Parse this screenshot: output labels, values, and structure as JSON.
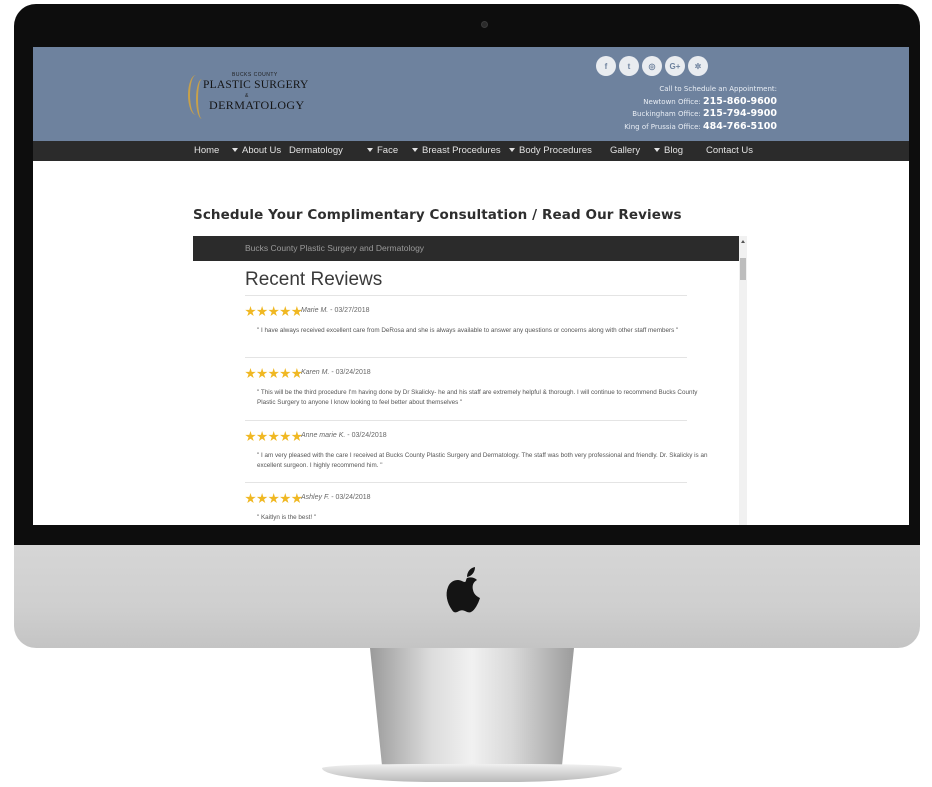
{
  "logo": {
    "small_line": "BUCKS COUNTY",
    "line1": "PLASTIC SURGERY",
    "ampersand": "&",
    "line2": "DERMATOLOGY"
  },
  "social_icons": [
    {
      "name": "facebook-icon",
      "glyph": "f"
    },
    {
      "name": "twitter-icon",
      "glyph": "t"
    },
    {
      "name": "instagram-icon",
      "glyph": "◎"
    },
    {
      "name": "google-plus-icon",
      "glyph": "G+"
    },
    {
      "name": "yelp-icon",
      "glyph": "✲"
    }
  ],
  "contact": {
    "intro": "Call to Schedule an Appointment:",
    "newtown_label": "Newtown Office:",
    "newtown_phone": "215-860-9600",
    "buckingham_label": "Buckingham Office:",
    "buckingham_phone": "215-794-9900",
    "kop_label": "King of Prussia Office:",
    "kop_phone": "484-766-5100"
  },
  "nav": {
    "home": "Home",
    "about": "About Us",
    "dermatology": "Dermatology",
    "face": "Face",
    "breast": "Breast Procedures",
    "body": "Body Procedures",
    "gallery": "Gallery",
    "blog": "Blog",
    "contact": "Contact Us"
  },
  "headline": "Schedule Your Complimentary Consultation / Read Our Reviews",
  "widget": {
    "bar_title": "Bucks County Plastic Surgery and Dermatology",
    "title": "Recent Reviews"
  },
  "reviews": [
    {
      "rating": 5,
      "author": "Marie M.",
      "date": " - 03/27/2018",
      "text": "\" I have always received excellent care from DeRosa and she is always available to answer any questions or concerns along with other staff members \""
    },
    {
      "rating": 5,
      "author": "Karen M.",
      "date": " - 03/24/2018",
      "text": "\" This will be the third procedure I'm having done by Dr Skalicky- he and his staff are extremely helpful & thorough. I will continue to recommend Bucks County Plastic Surgery to anyone I know looking to feel better about themselves \""
    },
    {
      "rating": 5,
      "author": "Anne marie K.",
      "date": " - 03/24/2018",
      "text": "\" I am very pleased with the care I received at Bucks County Plastic Surgery and Dermatology. The staff was both very professional and friendly. Dr. Skalicky is an excellent surgeon. I highly recommend him. \""
    },
    {
      "rating": 5,
      "author": "Ashley F.",
      "date": " - 03/24/2018",
      "text": "\" Kaitlyn is the best! \""
    }
  ],
  "colors": {
    "header_bg": "#6e829e",
    "nav_bg": "#2b2b2b",
    "star": "#f0b823"
  }
}
